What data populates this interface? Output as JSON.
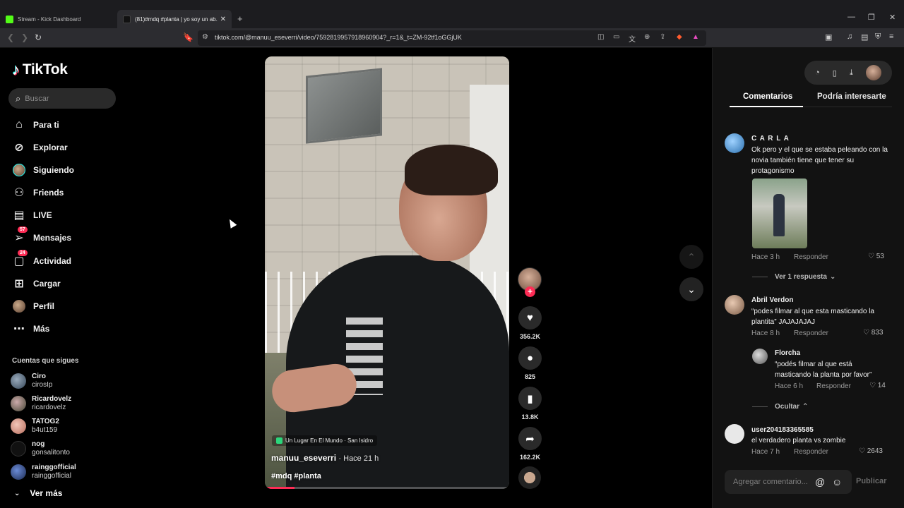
{
  "browser": {
    "tabs": [
      {
        "title": "Stream - Kick Dashboard",
        "favicon_color": "#53fc18"
      },
      {
        "title": "(81)#mdq #planta | yo soy un ab...",
        "favicon_color": "#111111"
      }
    ],
    "url": "tiktok.com/@manuu_eseverri/video/7592819957918960904?_r=1&_t=ZM-92tf1oGGjUK"
  },
  "sidebar": {
    "logo": "TikTok",
    "search_placeholder": "Buscar",
    "nav": [
      {
        "label": "Para ti",
        "icon": "home-icon"
      },
      {
        "label": "Explorar",
        "icon": "compass-icon"
      },
      {
        "label": "Siguiendo",
        "icon": "following-avatar-icon"
      },
      {
        "label": "Friends",
        "icon": "friends-icon"
      },
      {
        "label": "LIVE",
        "icon": "live-icon"
      },
      {
        "label": "Mensajes",
        "icon": "inbox-icon",
        "badge": "57"
      },
      {
        "label": "Actividad",
        "icon": "activity-icon",
        "badge": "24"
      },
      {
        "label": "Cargar",
        "icon": "upload-icon"
      },
      {
        "label": "Perfil",
        "icon": "profile-avatar-icon"
      },
      {
        "label": "Más",
        "icon": "more-icon"
      }
    ],
    "following_header": "Cuentas que sigues",
    "following": [
      {
        "name": "Ciro",
        "handle": "cirosIp"
      },
      {
        "name": "Ricardovelz",
        "handle": "ricardovelz"
      },
      {
        "name": "TATOG2",
        "handle": "b4ut159"
      },
      {
        "name": "nog",
        "handle": "gonsalitonto"
      },
      {
        "name": "rainggofficial",
        "handle": "rainggofficial"
      }
    ],
    "see_more": "Ver más"
  },
  "video": {
    "location": "Un Lugar En El Mundo · San Isidro",
    "username": "manuu_eseverri",
    "time": "· Hace 21 h",
    "tags": "#mdq #planta",
    "progress": 0.12
  },
  "actions": {
    "likes": "356.2K",
    "comments": "825",
    "saves": "13.8K",
    "shares": "162.2K"
  },
  "panel": {
    "tabs": [
      "Comentarios",
      "Podría interesarte"
    ],
    "comments": [
      {
        "name": "C A R L A",
        "text": "Ok pero y el que se estaba peleando con la novia también tiene que tener su protagonismo",
        "time": "Hace 3 h",
        "reply": "Responder",
        "likes": "53",
        "view_replies": "Ver 1 respuesta"
      },
      {
        "name": "Abril Verdon",
        "text": "“podes filmar al que esta masticando la plantita” JAJAJAJAJ",
        "time": "Hace 8 h",
        "reply": "Responder",
        "likes": "833"
      },
      {
        "name": "Florcha",
        "text": "“podés filmar al que está masticando la planta por favor”",
        "time": "Hace 6 h",
        "reply": "Responder",
        "likes": "14",
        "hide": "Ocultar"
      },
      {
        "name": "user204183365585",
        "text": "el verdadero planta vs zombie",
        "time": "Hace 7 h",
        "reply": "Responder",
        "likes": "2643"
      }
    ],
    "add_comment_placeholder": "Agregar comentario...",
    "publish": "Publicar"
  }
}
